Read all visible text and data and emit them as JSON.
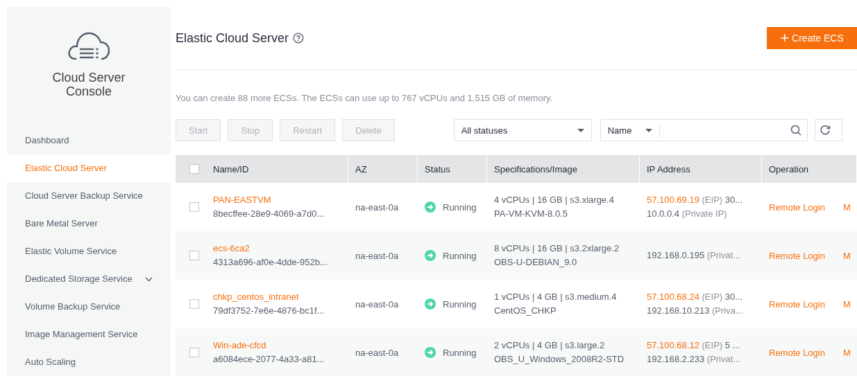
{
  "sidebar": {
    "title_lines": [
      "Cloud Server",
      "Console"
    ],
    "items": [
      {
        "label": "Dashboard",
        "selected": false
      },
      {
        "label": "Elastic Cloud Server",
        "selected": true
      },
      {
        "label": "Cloud Server Backup Service",
        "selected": false
      },
      {
        "label": "Bare Metal Server",
        "selected": false
      },
      {
        "label": "Elastic Volume Service",
        "selected": false
      },
      {
        "label": "Dedicated Storage Service",
        "selected": false,
        "expandable": true
      },
      {
        "label": "Volume Backup Service",
        "selected": false
      },
      {
        "label": "Image Management Service",
        "selected": false
      },
      {
        "label": "Auto Scaling",
        "selected": false
      }
    ]
  },
  "header": {
    "title": "Elastic Cloud Server",
    "create_button": {
      "icon": "+",
      "label": "Create ECS"
    }
  },
  "quota_text": "You can create 88 more ECSs. The ECSs can use up to 767 vCPUs and 1,515 GB of memory.",
  "toolbar": {
    "buttons": [
      {
        "label": "Start",
        "disabled": true
      },
      {
        "label": "Stop",
        "disabled": true
      },
      {
        "label": "Restart",
        "disabled": true
      },
      {
        "label": "Delete",
        "disabled": true
      }
    ],
    "status_filter": "All statuses",
    "search_by": "Name"
  },
  "table": {
    "select_all_checked": false,
    "columns": [
      "Name/ID",
      "AZ",
      "Status",
      "Specifications/Image",
      "IP Address",
      "Operation"
    ],
    "rows": [
      {
        "checked": false,
        "name": "PAN-EASTVM",
        "id": "8becffee-28e9-4069-a7d0...",
        "az": "na-east-0a",
        "status": {
          "kind": "running",
          "label": "Running"
        },
        "spec": "4 vCPUs | 16 GB | s3.xlarge.4",
        "image": "PA-VM-KVM-8.0.5",
        "ips": [
          {
            "kind": "eip",
            "address": "57.100.69.19",
            "note": "(EIP)",
            "extra": "30..."
          },
          {
            "kind": "private",
            "address": "10.0.0.4",
            "note": "(Private IP)"
          }
        ],
        "operations": [
          "Remote Login",
          "M"
        ]
      },
      {
        "checked": false,
        "name": "ecs-6ca2",
        "id": "4313a696-af0e-4dde-952b...",
        "az": "na-east-0a",
        "status": {
          "kind": "running",
          "label": "Running"
        },
        "spec": "8 vCPUs | 16 GB | s3.2xlarge.2",
        "image": "OBS-U-DEBIAN_9.0",
        "ips": [
          {
            "kind": "private",
            "address": "192.168.0.195",
            "note": "(Privat..."
          }
        ],
        "operations": [
          "Remote Login",
          "M"
        ]
      },
      {
        "checked": false,
        "name": "chkp_centos_intranet",
        "id": "79df3752-7e6e-4876-bc1f...",
        "az": "na-east-0a",
        "status": {
          "kind": "running",
          "label": "Running"
        },
        "spec": "1 vCPUs | 4 GB | s3.medium.4",
        "image": "CentOS_CHKP",
        "ips": [
          {
            "kind": "eip",
            "address": "57.100.68.24",
            "note": "(EIP)",
            "extra": "30..."
          },
          {
            "kind": "private",
            "address": "192.168.10.213",
            "note": "(Priva..."
          }
        ],
        "operations": [
          "Remote Login",
          "M"
        ]
      },
      {
        "checked": false,
        "name": "Win-ade-cfcd",
        "id": "a6084ece-2077-4a33-a81...",
        "az": "na-east-0a",
        "status": {
          "kind": "running",
          "label": "Running"
        },
        "spec": "2 vCPUs | 4 GB | s3.large.2",
        "image": "OBS_U_Windows_2008R2-STD",
        "ips": [
          {
            "kind": "eip",
            "address": "57.100.68.12",
            "note": "(EIP)",
            "extra": "5 ..."
          },
          {
            "kind": "private",
            "address": "192.168.2.233",
            "note": "(Privat..."
          }
        ],
        "operations": [
          "Remote Login",
          "M"
        ]
      }
    ]
  }
}
